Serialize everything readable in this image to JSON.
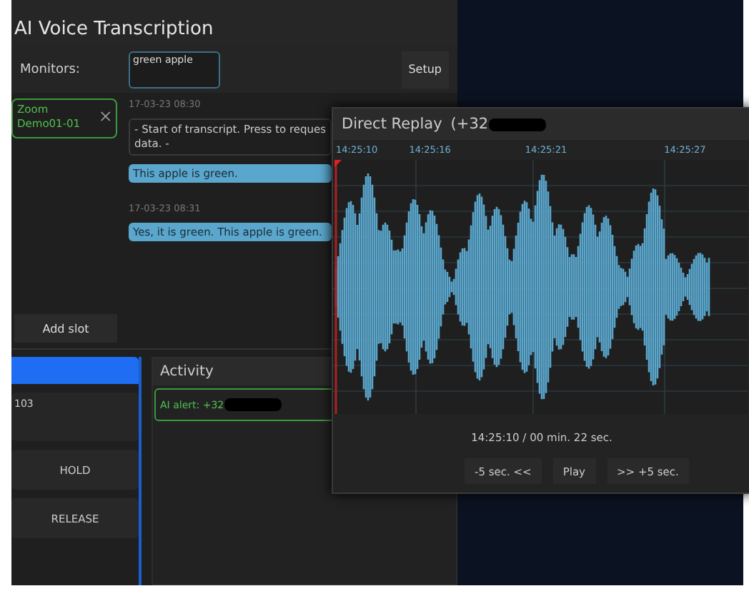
{
  "transcription": {
    "title": "AI Voice Transcription",
    "monitors_label": "Monitors:",
    "monitors_field": {
      "value": "green apple"
    },
    "setup_button": "Setup",
    "slot": {
      "name": "Zoom Demo01-01"
    },
    "messages": [
      {
        "kind": "timestamp",
        "text": "17-03-23 08:30"
      },
      {
        "kind": "system",
        "lines": [
          "- Start of transcript. Press to reques",
          "data. -"
        ]
      },
      {
        "kind": "bubble",
        "text": "This apple is green."
      },
      {
        "kind": "timestamp",
        "text": "17-03-23 08:31"
      },
      {
        "kind": "bubble",
        "text": "Yes, it is green. This apple is green."
      }
    ],
    "add_slot_button": "Add slot"
  },
  "call_panel": {
    "number": "103",
    "buttons": [
      "HOLD",
      "RELEASE"
    ]
  },
  "activity": {
    "title": "Activity",
    "alerts": [
      {
        "text": "AI alert: +32",
        "redacted": true
      }
    ]
  },
  "replay": {
    "title": "Direct Replay",
    "number": "(+32",
    "redacted": true,
    "time_labels": [
      "14:25:10",
      "14:25:16",
      "14:25:21",
      "14:25:27"
    ],
    "position": "14:25:10 / 00 min. 22 sec.",
    "buttons": [
      "-5 sec. <<",
      "Play",
      ">> +5 sec."
    ]
  }
}
